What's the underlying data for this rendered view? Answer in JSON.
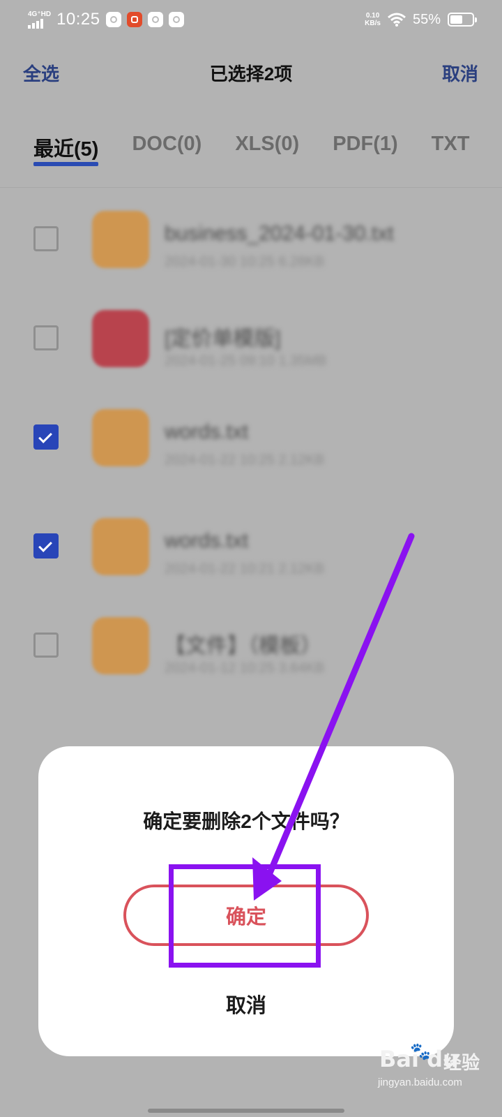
{
  "status_bar": {
    "network": "4G⁺HD",
    "time": "10:25",
    "speed_value": "0.10",
    "speed_unit": "KB/s",
    "battery_percent": "55%",
    "battery_level": 0.55
  },
  "header": {
    "select_all": "全选",
    "title": "已选择2项",
    "cancel": "取消"
  },
  "tabs": [
    {
      "label": "最近(5)",
      "active": true
    },
    {
      "label": "DOC(0)",
      "active": false
    },
    {
      "label": "XLS(0)",
      "active": false
    },
    {
      "label": "PDF(1)",
      "active": false
    },
    {
      "label": "TXT",
      "active": false
    }
  ],
  "files": [
    {
      "name": "business_2024-01-30.txt",
      "meta": "2024-01-30 10:25  6.28KB",
      "icon": "txt-file-icon",
      "checked": false
    },
    {
      "name": "[定价单模版]",
      "meta": "2024-01-25 09:10  1.35MB",
      "icon": "pdf-file-icon",
      "checked": false
    },
    {
      "name": "words.txt",
      "meta": "2024-01-22 10:25  2.12KB",
      "icon": "txt-file-icon",
      "checked": true
    },
    {
      "name": "words.txt",
      "meta": "2024-01-22 10:21  2.12KB",
      "icon": "txt-file-icon",
      "checked": true
    },
    {
      "name": "【文件】（模板）",
      "meta": "2024-01-12 10:25  3.64KB",
      "icon": "txt-file-icon",
      "checked": false
    }
  ],
  "dialog": {
    "message": "确定要删除2个文件吗？",
    "confirm": "确定",
    "cancel": "取消"
  },
  "watermark": {
    "brand": "Bai du",
    "suffix": "经验",
    "url": "jingyan.baidu.com"
  },
  "colors": {
    "accent": "#2a4bb3",
    "danger": "#d9525b",
    "annotation": "#8a12f0"
  }
}
